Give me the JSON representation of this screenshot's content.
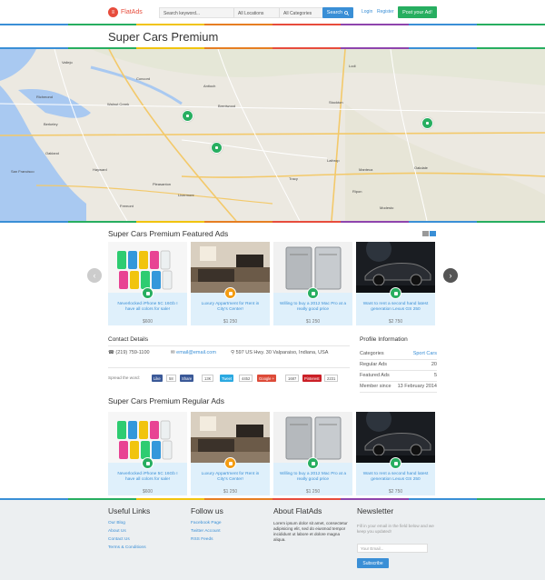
{
  "header": {
    "logo_text": "FlatAds",
    "search_placeholder": "Search keyword...",
    "location_select": "All Locations",
    "category_select": "All Categories",
    "search_button": "Search",
    "login": "Login",
    "register": "Register",
    "post_button": "Post your Ad!"
  },
  "page_title": "Super Cars Premium",
  "map_labels": [
    "Vallejo",
    "Concord",
    "Richmond",
    "Walnut Creek",
    "Berkeley",
    "Oakland",
    "San Francisco",
    "Hayward",
    "Fremont",
    "Livermore",
    "Pleasanton",
    "Antioch",
    "Brentwood",
    "Stockton",
    "Lodi",
    "Tracy",
    "Manteca",
    "Modesto",
    "Oakdale",
    "Lathrop",
    "Ripon"
  ],
  "featured": {
    "title": "Super Cars Premium Featured Ads",
    "ads": [
      {
        "title": "Neverlocked iPhone 5C 16Gb I have all colors for sale!",
        "price": "$600",
        "cat_color": "#27ae60"
      },
      {
        "title": "Luxury Appartment for Rent in City's Center!",
        "price": "$1 250",
        "cat_color": "#f39c12"
      },
      {
        "title": "Willing to buy a 2012 Mac Pro at a really good price",
        "price": "$1 250",
        "cat_color": "#27ae60"
      },
      {
        "title": "Want to rent a second hand latest generation Lexus GS 250",
        "price": "$2 750",
        "cat_color": "#27ae60"
      }
    ]
  },
  "contact": {
    "title": "Contact Details",
    "phone": "(219) 759-1100",
    "email": "email@email.com",
    "address": "597 US Hwy. 30 Valparaiso, Indiana, USA"
  },
  "profile": {
    "title": "Profile Information",
    "rows": [
      {
        "label": "Categories",
        "value": "Sport Cars"
      },
      {
        "label": "Regular Ads",
        "value": "20"
      },
      {
        "label": "Featured Ads",
        "value": "5"
      },
      {
        "label": "Member since",
        "value": "13 February 2014"
      }
    ]
  },
  "share": {
    "label": "Spread the word:",
    "like": "Like",
    "like_count": "58",
    "fb_share": "Share",
    "fb_count": "13K",
    "tweet": "Tweet",
    "tweet_count": "4452",
    "gplus": "Google +",
    "gplus_count": "1687",
    "pinterest": "Pinterest",
    "pin_count": "2231"
  },
  "regular": {
    "title": "Super Cars Premium Regular Ads",
    "ads": [
      {
        "title": "Neverlocked iPhone 5C 16Gb I have all colors for sale!",
        "price": "$600",
        "cat_color": "#27ae60"
      },
      {
        "title": "Luxury Appartment for Rent in City's Center!",
        "price": "$1 250",
        "cat_color": "#f39c12"
      },
      {
        "title": "Willing to buy a 2012 Mac Pro at a really good price",
        "price": "$1 250",
        "cat_color": "#27ae60"
      },
      {
        "title": "Want to rent a second hand latest generation Lexus GS 250",
        "price": "$2 750",
        "cat_color": "#27ae60"
      }
    ]
  },
  "footer": {
    "useful_title": "Useful Links",
    "useful_links": [
      "Our Blog",
      "About Us",
      "Contact Us",
      "Terms & Conditions"
    ],
    "follow_title": "Follow us",
    "follow_links": [
      "Facebook Page",
      "Twitter Account",
      "RSS Feeds"
    ],
    "about_title": "About FlatAds",
    "about_text": "Lorem ipsum dolor sit amet, consectetur adipisicing elit, sed do eiusmod tempor incididunt ut labore et dolore magna aliqua.",
    "news_title": "Newsletter",
    "news_text": "Fill in your email in the field below and we keep you updated!",
    "email_placeholder": "Your Email...",
    "subscribe": "Subscribe"
  },
  "colors": {
    "accent": "#3a8fd6",
    "green": "#27ae60",
    "orange": "#f39c12",
    "red": "#e74c3c"
  }
}
